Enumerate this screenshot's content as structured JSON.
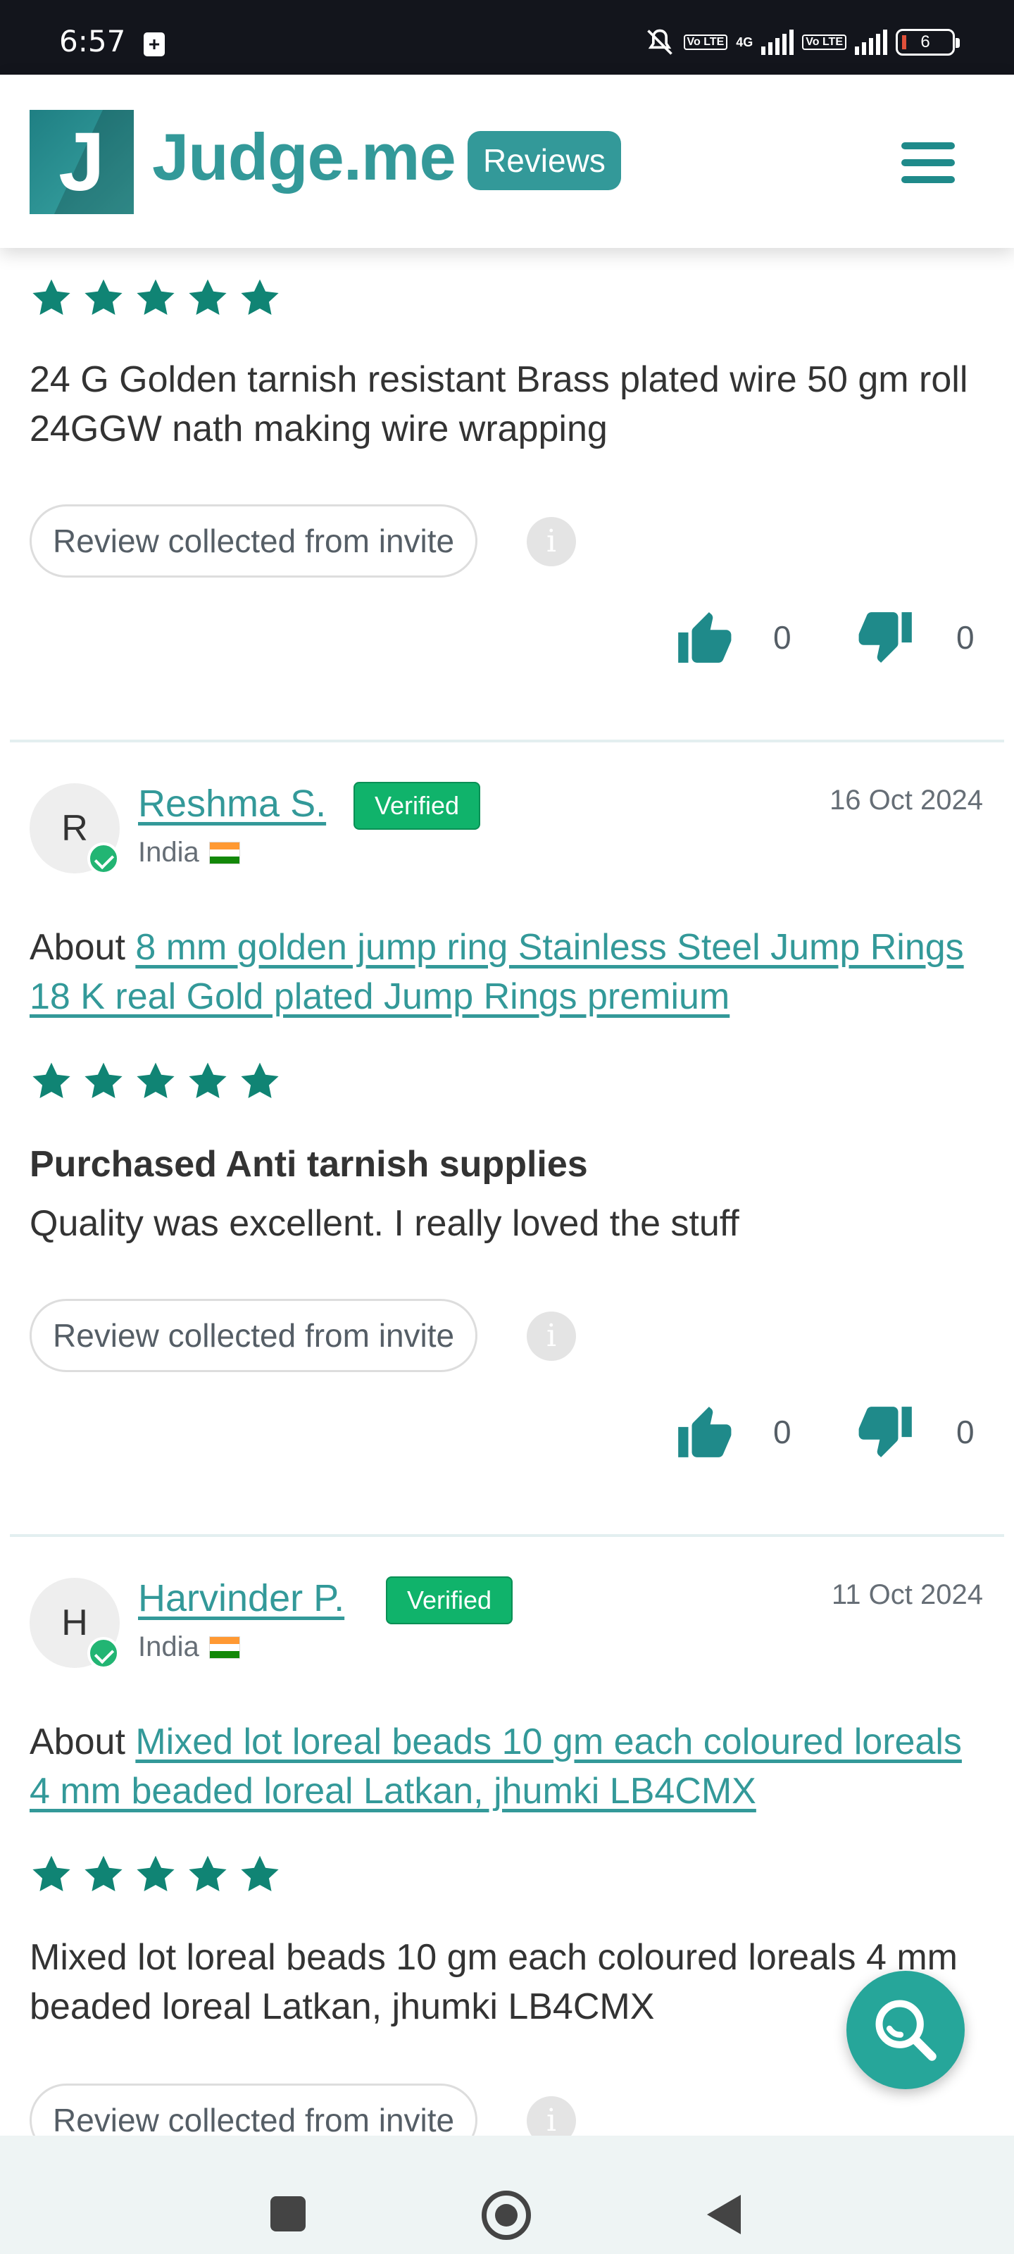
{
  "status_bar": {
    "time": "6:57",
    "network": "4G",
    "volte_label": "Vo LTE",
    "battery": "6"
  },
  "header": {
    "logo_letter": "J",
    "brand": "Judge.me",
    "badge": "Reviews",
    "menu_icon": "hamburger-icon"
  },
  "reviews": [
    {
      "rating": 5,
      "body": "24 G Golden tarnish resistant Brass plated wire 50 gm roll 24GGW nath making wire wrapping",
      "source_label": "Review collected from invite",
      "info_label": "i",
      "thumbs_up_count": "0",
      "thumbs_down_count": "0"
    },
    {
      "avatar_initial": "R",
      "name": "Reshma S.",
      "verified_label": "Verified",
      "country": "India",
      "date": "16 Oct 2024",
      "about_prefix": "About",
      "product": "8 mm golden jump ring Stainless Steel Jump Rings 18 K real Gold plated Jump Rings premium",
      "rating": 5,
      "title": "Purchased Anti tarnish supplies",
      "body": "Quality was excellent. I really loved the stuff",
      "source_label": "Review collected from invite",
      "info_label": "i",
      "thumbs_up_count": "0",
      "thumbs_down_count": "0"
    },
    {
      "avatar_initial": "H",
      "name": "Harvinder P.",
      "verified_label": "Verified",
      "country": "India",
      "date": "11 Oct 2024",
      "about_prefix": "About",
      "product": "Mixed lot loreal beads 10 gm each coloured loreals 4 mm beaded loreal Latkan, jhumki LB4CMX",
      "rating": 5,
      "body": "Mixed lot loreal beads 10 gm each coloured loreals 4 mm beaded loreal Latkan, jhumki LB4CMX",
      "source_label": "Review collected from invite",
      "info_label": "i"
    }
  ],
  "colors": {
    "brand_teal": "#339999",
    "star_teal": "#108474",
    "verified_green": "#10b36b",
    "fab_teal": "#26a69a"
  },
  "icons": {
    "star": "star-icon",
    "thumbs_up": "thumbs-up-icon",
    "thumbs_down": "thumbs-down-icon",
    "search": "search-icon",
    "flag": "india-flag-icon"
  }
}
